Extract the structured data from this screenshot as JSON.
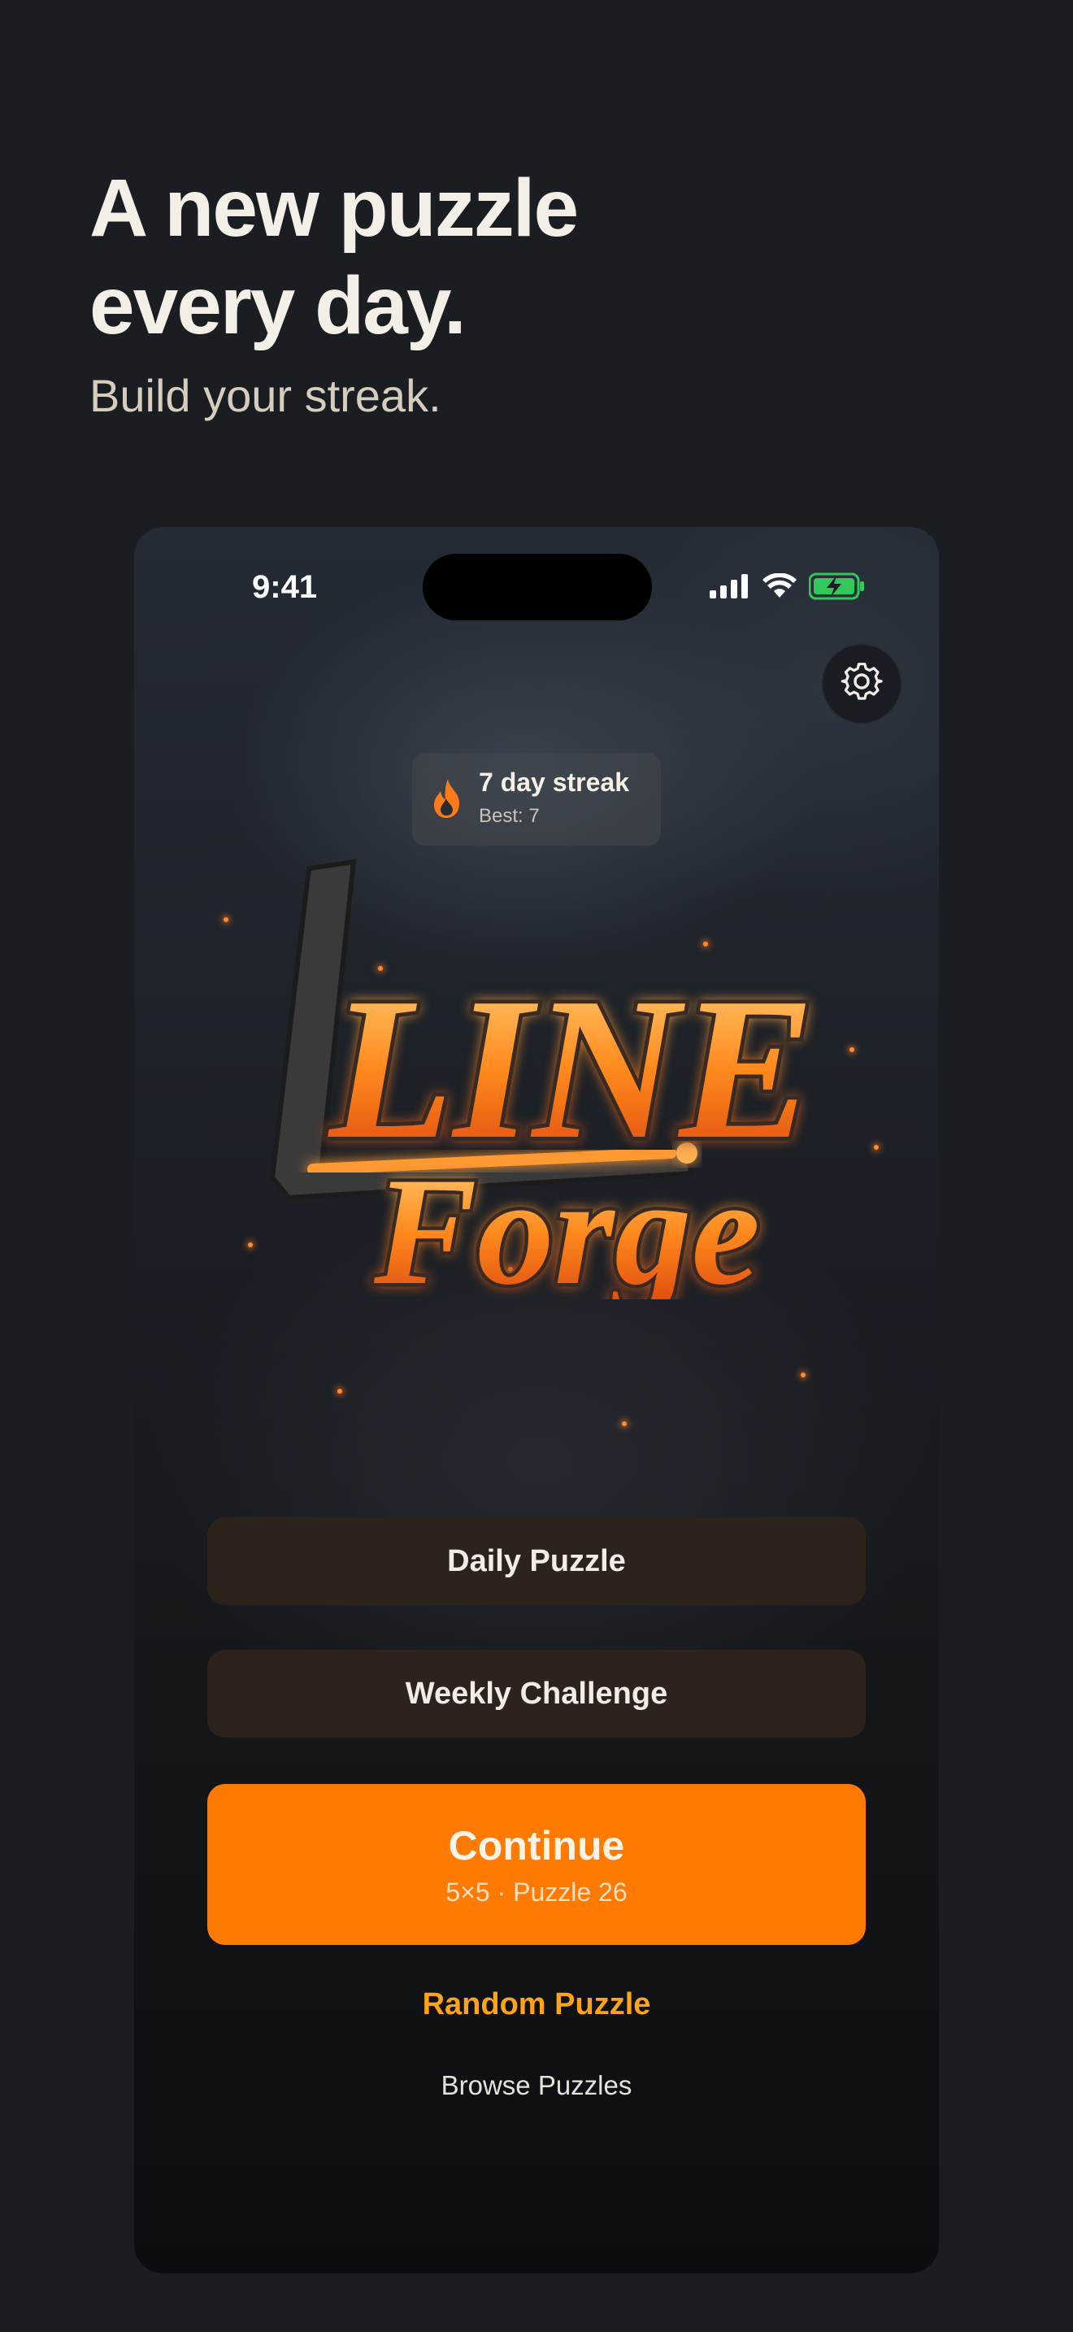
{
  "marketing": {
    "headline_line1": "A new puzzle",
    "headline_line2": "every day.",
    "subhead": "Build your streak."
  },
  "status_bar": {
    "time": "9:41",
    "icons": [
      "cellular-signal-icon",
      "wifi-icon",
      "battery-charging-icon"
    ]
  },
  "header": {
    "settings_icon": "gear-icon"
  },
  "streak": {
    "icon": "flame-icon",
    "title": "7 day streak",
    "best": "Best: 7"
  },
  "logo": {
    "line1": "LINE",
    "line2": "Forge"
  },
  "menu": {
    "daily_label": "Daily Puzzle",
    "weekly_label": "Weekly Challenge",
    "continue_label": "Continue",
    "continue_detail": "5×5 · Puzzle 26",
    "random_label": "Random Puzzle",
    "browse_label": "Browse Puzzles"
  },
  "colors": {
    "page_background": "#1a1d21",
    "accent_orange": "#ff7a00",
    "link_orange": "#ffa319",
    "dark_button": "#2c231b",
    "battery_green": "#34c759"
  }
}
